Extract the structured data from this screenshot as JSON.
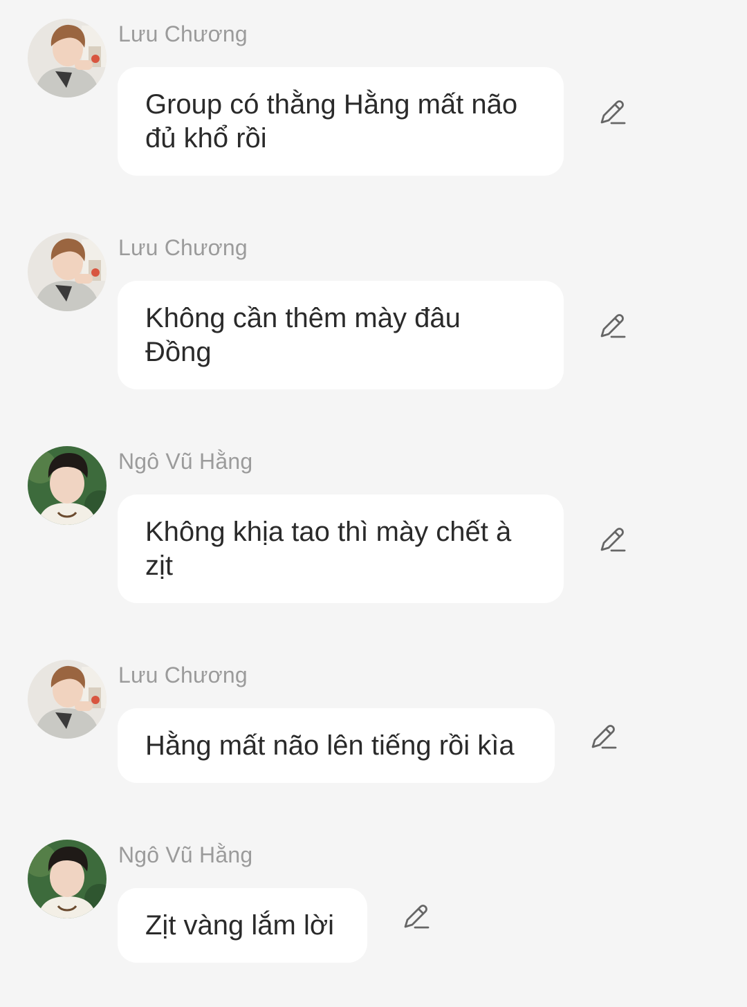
{
  "theme": {
    "background": "#f5f5f5",
    "bubble": "#ffffff",
    "sender_color": "#9b9b9b",
    "text_color": "#2a2a2a",
    "icon_color": "#666666"
  },
  "messages": [
    {
      "sender": "Lưu Chương",
      "avatar_icon": "user-avatar-luu-chuong",
      "text": "Group có thằng Hằng mất não\nđủ khổ rồi",
      "action_icon": "pencil-edit-icon"
    },
    {
      "sender": "Lưu Chương",
      "avatar_icon": "user-avatar-luu-chuong",
      "text": "Không cần thêm mày đâu\nĐồng",
      "action_icon": "pencil-edit-icon"
    },
    {
      "sender": "Ngô Vũ Hằng",
      "avatar_icon": "user-avatar-ngo-vu-hang",
      "text": "Không khịa tao thì mày chết à\nzịt",
      "action_icon": "pencil-edit-icon"
    },
    {
      "sender": "Lưu Chương",
      "avatar_icon": "user-avatar-luu-chuong",
      "text": "Hằng mất não lên tiếng rồi kìa",
      "action_icon": "pencil-edit-icon"
    },
    {
      "sender": "Ngô Vũ Hằng",
      "avatar_icon": "user-avatar-ngo-vu-hang",
      "text": "Zịt vàng lắm lời",
      "action_icon": "pencil-edit-icon"
    }
  ]
}
